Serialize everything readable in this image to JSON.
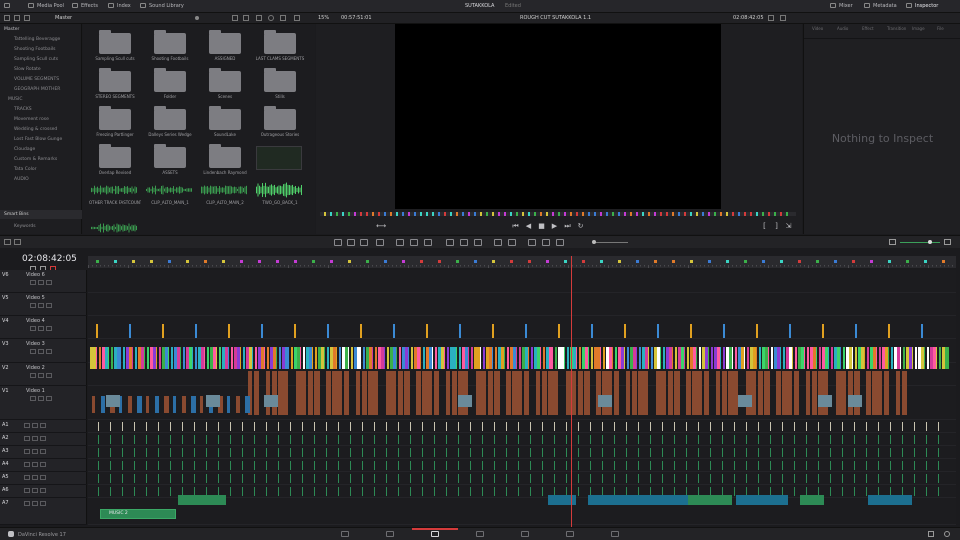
{
  "topbar": {
    "media_pool": "Media Pool",
    "effects": "Effects",
    "edit_index": "Index",
    "sound_library": "Sound Library",
    "project_title": "SUTAKKOLA",
    "project_status": "Edited",
    "mixer": "Mixer",
    "metadata": "Metadata",
    "inspector": "Inspector"
  },
  "secbar": {
    "bin_name": "Master",
    "zoom": "15%",
    "timecode_src": "00:57:51:01",
    "viewer_title": "ROUGH CUT SUTAKKOLA 1.1",
    "timecode_rec": "02:08:42:05"
  },
  "bins": {
    "master": "Master",
    "items": [
      "Tattelling Beveragge",
      "Shooting Footbails",
      "Sampling Scull cuts",
      "Slow Rotate",
      "VOLUME SEGMENTS",
      "GEOGRAPH MOTHER",
      "MUSIC",
      "TRACKS",
      "Movement rose",
      "Wedding & crossed",
      "Lost Fast Blow Gunge",
      "Cloudage",
      "Custom & Remarks",
      "Tata Color",
      "AUDIO"
    ],
    "smart_bins": "Smart Bins",
    "keywords": "Keywords"
  },
  "media_pool": {
    "folders": [
      "Sampling Scull cuts",
      "Shooting Footbails",
      "ASSIGNED",
      "LAST CLAMS SEGMENTS",
      "STEREO SEGMENTS",
      "Folder",
      "Scenes",
      "Stills",
      "Freezing Partlinger",
      "Dalleys Series Wedge",
      "SoundLake",
      "Outrageous Stories",
      "Overlap Revised",
      "ASSETS",
      "Lindenbach Raymond"
    ],
    "clips": [
      "OTHER TRACK FASTCOUNT",
      "CLIP_ALTO_MAIN_1",
      "CLIP_ALTO_MAIN_2",
      "TWO_GO_BACK_1",
      "TWO_GO_BACK_2"
    ]
  },
  "inspector": {
    "tabs": [
      "Video",
      "Audio",
      "Effect",
      "Transition",
      "Image",
      "File"
    ],
    "empty_message": "Nothing to Inspect"
  },
  "timeline": {
    "timecode": "02:08:42:05",
    "tracks": [
      {
        "id": "V6",
        "name": "Video 6"
      },
      {
        "id": "V5",
        "name": "Video 5"
      },
      {
        "id": "V4",
        "name": "Video 4"
      },
      {
        "id": "V3",
        "name": "Video 3"
      },
      {
        "id": "V2",
        "name": "Video 2"
      },
      {
        "id": "V1",
        "name": "Video 1"
      },
      {
        "id": "A1",
        "name": "A1"
      },
      {
        "id": "A2",
        "name": "A2"
      },
      {
        "id": "A3",
        "name": "A3"
      },
      {
        "id": "A4",
        "name": "A4"
      },
      {
        "id": "A5",
        "name": "A5"
      },
      {
        "id": "A6",
        "name": "A6"
      },
      {
        "id": "A7",
        "name": "A7"
      }
    ],
    "music_clip": "MUSIC 2"
  },
  "bottombar": {
    "app_name": "DaVinci Resolve 17"
  },
  "colors": {
    "accent": "#d43b3b",
    "video_orange": "#8a4a30",
    "audio_green": "#2d8a55",
    "audio_teal": "#1c6f90"
  }
}
